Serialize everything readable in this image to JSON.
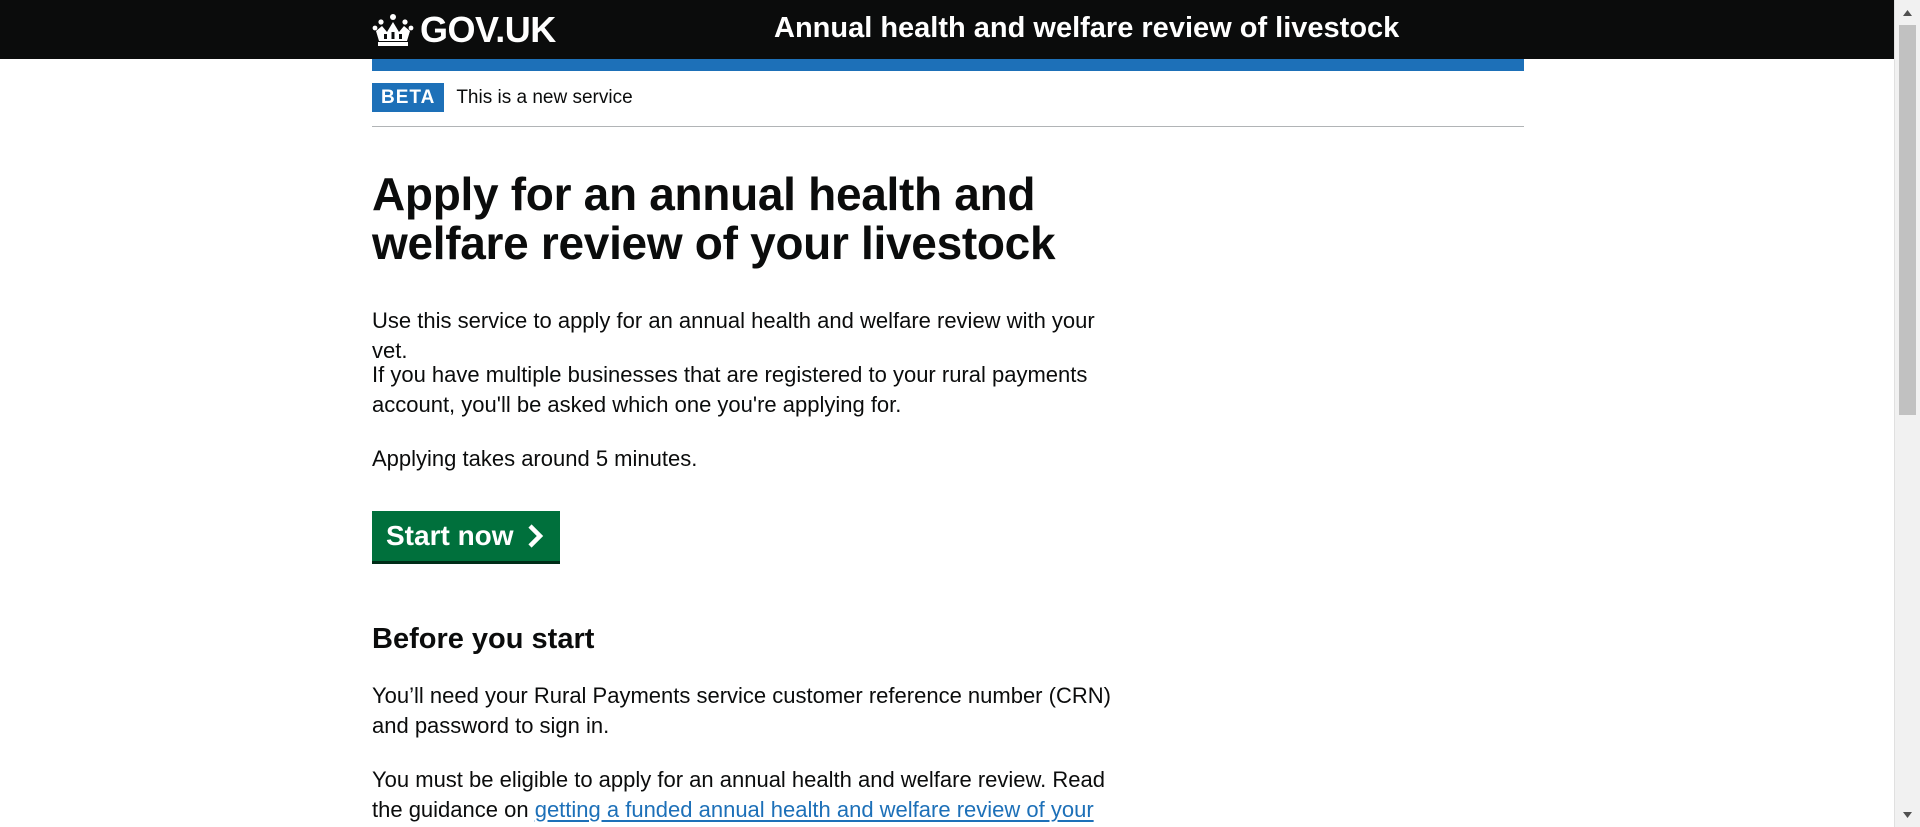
{
  "header": {
    "logo_text": "GOV.UK",
    "service_name": "Annual health and welfare review of livestock"
  },
  "phase_banner": {
    "tag": "BETA",
    "text": "This is a new service"
  },
  "main": {
    "title": "Apply for an annual health and welfare review of your livestock",
    "intro": "Use this service to apply for an annual health and welfare review with your vet.",
    "multiple_businesses": "If you have multiple businesses that are registered to your rural payments account, you'll be asked which one you're applying for.",
    "duration": "Applying takes around 5 minutes.",
    "start_button": "Start now",
    "before_you_start_heading": "Before you start",
    "crn_text": "You’ll need your Rural Payments service customer reference number (CRN) and password to sign in.",
    "eligibility_text": "You must be eligible to apply for an annual health and welfare review. Read the guidance on ",
    "eligibility_link": "getting a funded annual health and welfare review of your"
  },
  "colors": {
    "header_bg": "#0b0c0c",
    "accent_blue": "#1d70b8",
    "start_green": "#00703c",
    "link": "#1d70b8",
    "text": "#0b0c0c"
  }
}
